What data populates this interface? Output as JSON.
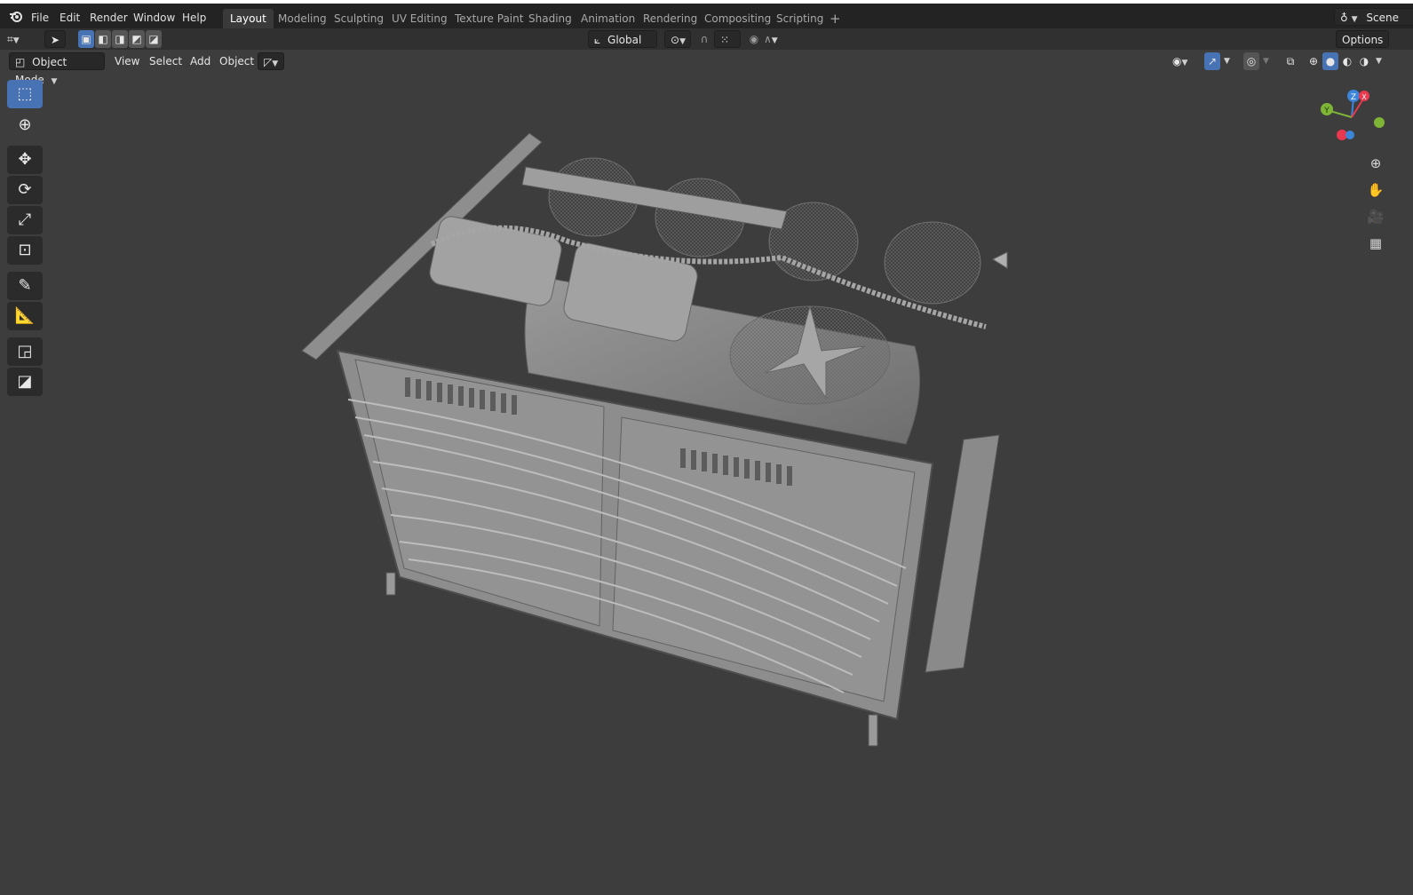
{
  "menu": {
    "items": [
      "File",
      "Edit",
      "Render",
      "Window",
      "Help"
    ]
  },
  "workspaces": {
    "tabs": [
      "Layout",
      "Modeling",
      "Sculpting",
      "UV Editing",
      "Texture Paint",
      "Shading",
      "Animation",
      "Rendering",
      "Compositing",
      "Scripting"
    ],
    "active": "Layout",
    "add_label": "+"
  },
  "scene": {
    "label": "Scene"
  },
  "tool_header": {
    "orientation": "Global",
    "options_label": "Options"
  },
  "viewport_header": {
    "mode": "Object Mode",
    "menus": [
      "View",
      "Select",
      "Add",
      "Object"
    ]
  },
  "toolbar": {
    "tools": [
      "select-box",
      "cursor",
      "move",
      "rotate",
      "scale",
      "transform",
      "annotate",
      "measure",
      "add-cube",
      "add-shape"
    ],
    "active": "select-box"
  },
  "gizmo": {
    "axes": [
      "X",
      "Y",
      "Z"
    ],
    "colors": {
      "x": "#e8394e",
      "y": "#7fb536",
      "z": "#3d85d9"
    }
  },
  "colors": {
    "accent": "#4772b3",
    "viewport_bg": "#3d3d3d",
    "topbar_bg": "#232323",
    "model": "#8a8a8a"
  }
}
